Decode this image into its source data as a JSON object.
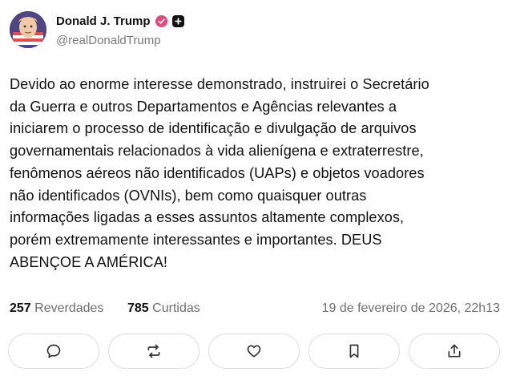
{
  "author": {
    "display_name": "Donald J. Trump",
    "handle": "@realDonaldTrump"
  },
  "post": {
    "text": "Devido ao enorme interesse demonstrado, instruirei o Secretário\nda Guerra e outros Departamentos e Agências relevantes a\niniciarem o processo de identificação e divulgação de arquivos\ngovernamentais relacionados à vida alienígena e extraterrestre,\nfenômenos aéreos não identificados (UAPs) e objetos voadores\nnão identificados (OVNIs), bem como quaisquer outras\ninformações ligadas a esses assuntos altamente complexos,\nporém extremamente interessantes e importantes. DEUS\nABENÇOE A AMÉRICA!"
  },
  "stats": {
    "reposts_count": "257",
    "reposts_label": "Reverdades",
    "likes_count": "785",
    "likes_label": "Curtidas",
    "timestamp": "19 de fevereiro de 2026, 22h13"
  },
  "actions": [
    {
      "icon": "comment-icon"
    },
    {
      "icon": "repost-icon"
    },
    {
      "icon": "heart-icon"
    },
    {
      "icon": "bookmark-icon"
    },
    {
      "icon": "share-icon"
    }
  ],
  "colors": {
    "verified_badge": "#e8457c",
    "muted_text": "#6f6f6f",
    "button_border": "#dcdcdc"
  }
}
